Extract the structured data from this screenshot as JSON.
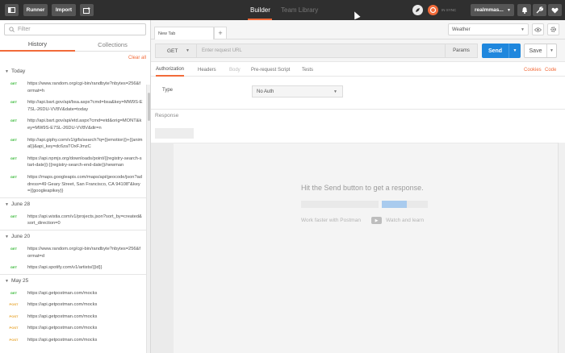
{
  "topbar": {
    "runner_label": "Runner",
    "import_label": "Import",
    "tabs": [
      {
        "label": "Builder"
      },
      {
        "label": "Team Library"
      }
    ],
    "sync_text": "IN SYNC",
    "user_label": "realmmas...",
    "accent_color": "#f26b3a"
  },
  "sidebar": {
    "filter_placeholder": "Filter",
    "tabs": [
      {
        "label": "History"
      },
      {
        "label": "Collections"
      }
    ],
    "clear_all_label": "Clear all",
    "groups": [
      {
        "label": "Today",
        "items": [
          {
            "method": "GET",
            "url": "https://www.random.org/cgi-bin/randbyte?nbytes=256&format=h"
          },
          {
            "method": "GET",
            "url": "http://api.bart.gov/api/bsa.aspx?cmd=bsa&key=MW9S-E7SL-26DU-VV8V&date=today"
          },
          {
            "method": "GET",
            "url": "http://api.bart.gov/api/etd.aspx?cmd=etd&orig=MONT&key=MW9S-E7SL-26DU-VV8V&dir=n"
          },
          {
            "method": "GET",
            "url": "http://api.giphy.com/v1/gifs/search?q={{emotion}}+{{animal}}&api_key=dc6zaTOxFJmzC"
          },
          {
            "method": "GET",
            "url": "https://api.npmjs.org/downloads/point/{{registry-search-start-date}}:{{registry-search-end-date}}/newman"
          },
          {
            "method": "GET",
            "url": "https://maps.googleapis.com/maps/api/geocode/json?address=49 Geary Street, San Francisco, CA 94108\"&key={{googleapikey}}"
          }
        ]
      },
      {
        "label": "June 28",
        "items": [
          {
            "method": "GET",
            "url": "https://api.wistia.com/v1/projects.json?sort_by=created&sort_direction=0"
          }
        ]
      },
      {
        "label": "June 20",
        "items": [
          {
            "method": "GET",
            "url": "https://www.random.org/cgi-bin/randbyte?nbytes=256&format=d"
          },
          {
            "method": "GET",
            "url": "https://api.spotify.com/v1/artists/{{id}}"
          }
        ]
      },
      {
        "label": "May 25",
        "items": [
          {
            "method": "GET",
            "url": "https://api.getpostman.com/mocks"
          },
          {
            "method": "POST",
            "url": "https://api.getpostman.com/mocks"
          },
          {
            "method": "POST",
            "url": "https://api.getpostman.com/mocks"
          },
          {
            "method": "POST",
            "url": "https://api.getpostman.com/mocks"
          },
          {
            "method": "POST",
            "url": "https://api.getpostman.com/mocks"
          }
        ]
      }
    ]
  },
  "main": {
    "tab_label": "New Tab",
    "add_tab_label": "+",
    "environment": "Weather",
    "method": "GET",
    "url_placeholder": "Enter request URL",
    "params_label": "Params",
    "send_label": "Send",
    "save_label": "Save",
    "subtabs": [
      {
        "label": "Authorization"
      },
      {
        "label": "Headers"
      },
      {
        "label": "Body"
      },
      {
        "label": "Pre-request Script"
      },
      {
        "label": "Tests"
      }
    ],
    "cookies_label": "Cookies",
    "code_label": "Code",
    "type_label": "Type",
    "auth_type": "No Auth",
    "response_label": "Response",
    "hit_send_text": "Hit the Send button to get a response.",
    "work_faster_text": "Work faster with Postman",
    "watch_learn_text": "Watch and learn"
  }
}
